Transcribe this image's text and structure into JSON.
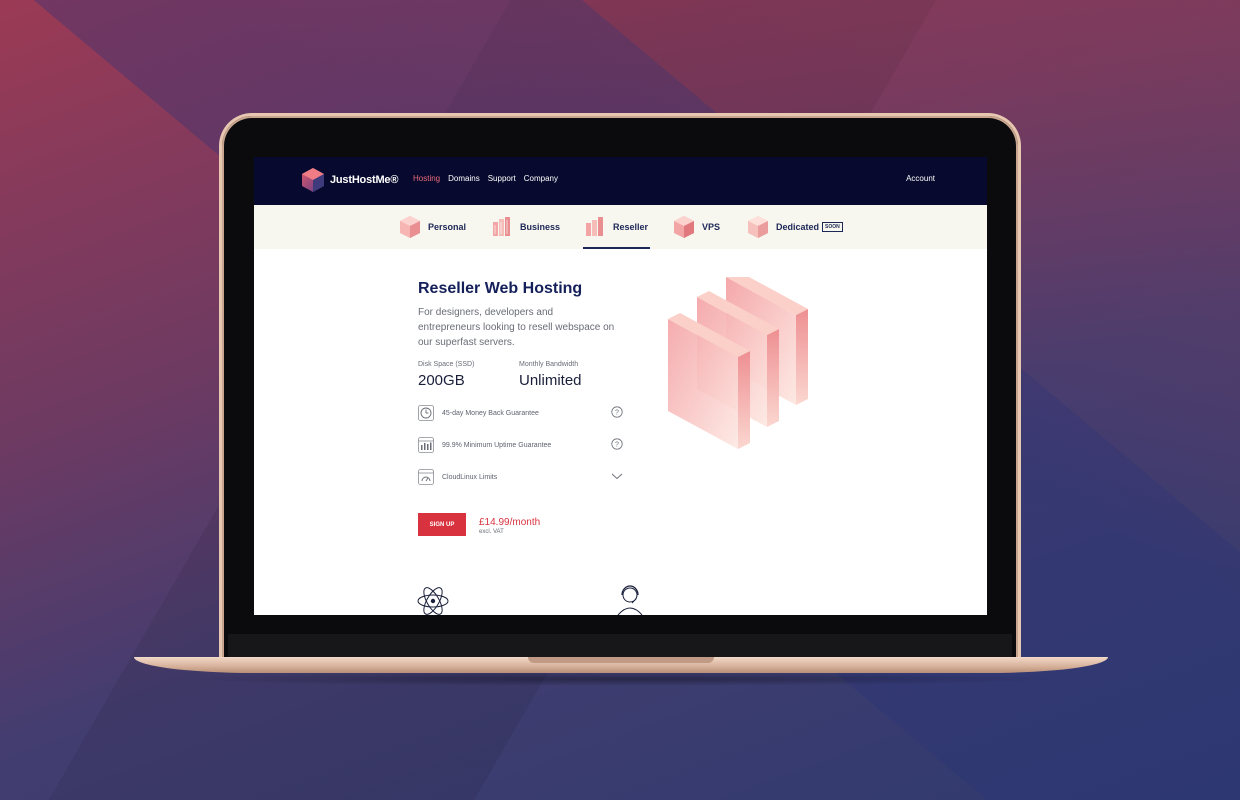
{
  "nav": {
    "brand": "JustHostMe®",
    "links": [
      {
        "label": "Hosting",
        "active": true
      },
      {
        "label": "Domains",
        "active": false
      },
      {
        "label": "Support",
        "active": false
      },
      {
        "label": "Company",
        "active": false
      }
    ],
    "account": "Account"
  },
  "subnav": {
    "tabs": [
      {
        "label": "Personal",
        "icon": "cube-icon"
      },
      {
        "label": "Business",
        "icon": "building-icon"
      },
      {
        "label": "Reseller",
        "icon": "reseller-icon",
        "active": true
      },
      {
        "label": "VPS",
        "icon": "cube-icon"
      },
      {
        "label": "Dedicated",
        "icon": "cube-icon",
        "badge": "SOON"
      }
    ]
  },
  "plan": {
    "title": "Reseller Web Hosting",
    "description": "For designers, developers and entrepreneurs looking to resell webspace on our superfast servers.",
    "specs": [
      {
        "label": "Disk Space (SSD)",
        "value": "200GB"
      },
      {
        "label": "Monthly Bandwidth",
        "value": "Unlimited"
      }
    ],
    "features": [
      {
        "label": "45-day Money Back Guarantee",
        "icon": "clock-money-icon",
        "action_icon": "help-icon"
      },
      {
        "label": "99.9% Minimum Uptime Guarantee",
        "icon": "uptime-chart-icon",
        "action_icon": "help-icon"
      },
      {
        "label": "CloudLinux Limits",
        "icon": "gauge-icon",
        "action_icon": "chevron-down-icon"
      }
    ],
    "signup_label": "SIGN UP",
    "price": "£14.99/month",
    "price_note": "excl. VAT"
  },
  "colors": {
    "nav_bg": "#070a2e",
    "accent": "#d8323f",
    "active_link": "#ec6b7a",
    "heading": "#15205a"
  }
}
